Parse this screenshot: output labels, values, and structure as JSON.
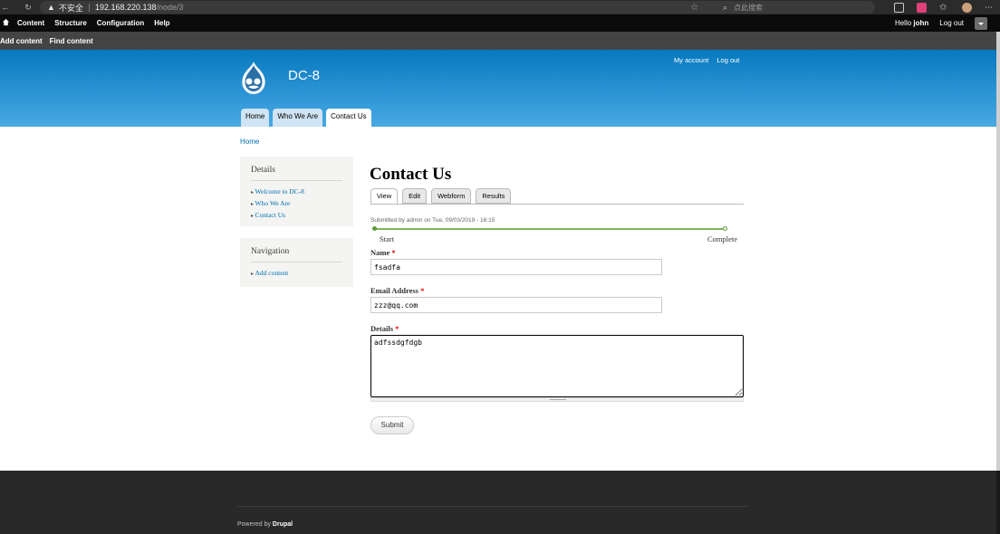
{
  "browser": {
    "security_label": "不安全",
    "host": "192.168.220.138",
    "path": "/node/3",
    "search_placeholder": "点此搜索"
  },
  "toolbar": {
    "items": [
      "Content",
      "Structure",
      "Configuration",
      "Help"
    ],
    "hello": "Hello ",
    "user": "john",
    "logout": "Log out"
  },
  "shortcuts": [
    "Add content",
    "Find content"
  ],
  "header": {
    "site_name": "DC-8",
    "secondary_menu": [
      "My account",
      "Log out"
    ],
    "main_tabs": [
      "Home",
      "Who We Are",
      "Contact Us"
    ],
    "active_tab": "Contact Us"
  },
  "breadcrumb": "Home",
  "sidebar": {
    "details_title": "Details",
    "details_items": [
      "Welcome to DC-8",
      "Who We Are",
      "Contact Us"
    ],
    "navigation_title": "Navigation",
    "navigation_items": [
      "Add content"
    ]
  },
  "content": {
    "title": "Contact Us",
    "local_tabs": [
      "View",
      "Edit",
      "Webform",
      "Results"
    ],
    "active_tab": "View",
    "submitted": "Submitted by admin on Tue, 09/03/2019 - 16:15",
    "progress": {
      "start_label": "Start",
      "end_label": "Complete",
      "value": 0
    },
    "name_label": "Name",
    "name_value": "fsadfa",
    "email_label": "Email Address",
    "email_value": "zzz@qq.com",
    "details_label": "Details",
    "details_value": "adfssdgfdgb",
    "required_mark": "*",
    "submit_label": "Submit"
  },
  "footer": {
    "powered_prefix": "Powered by ",
    "powered_link": "Drupal"
  }
}
